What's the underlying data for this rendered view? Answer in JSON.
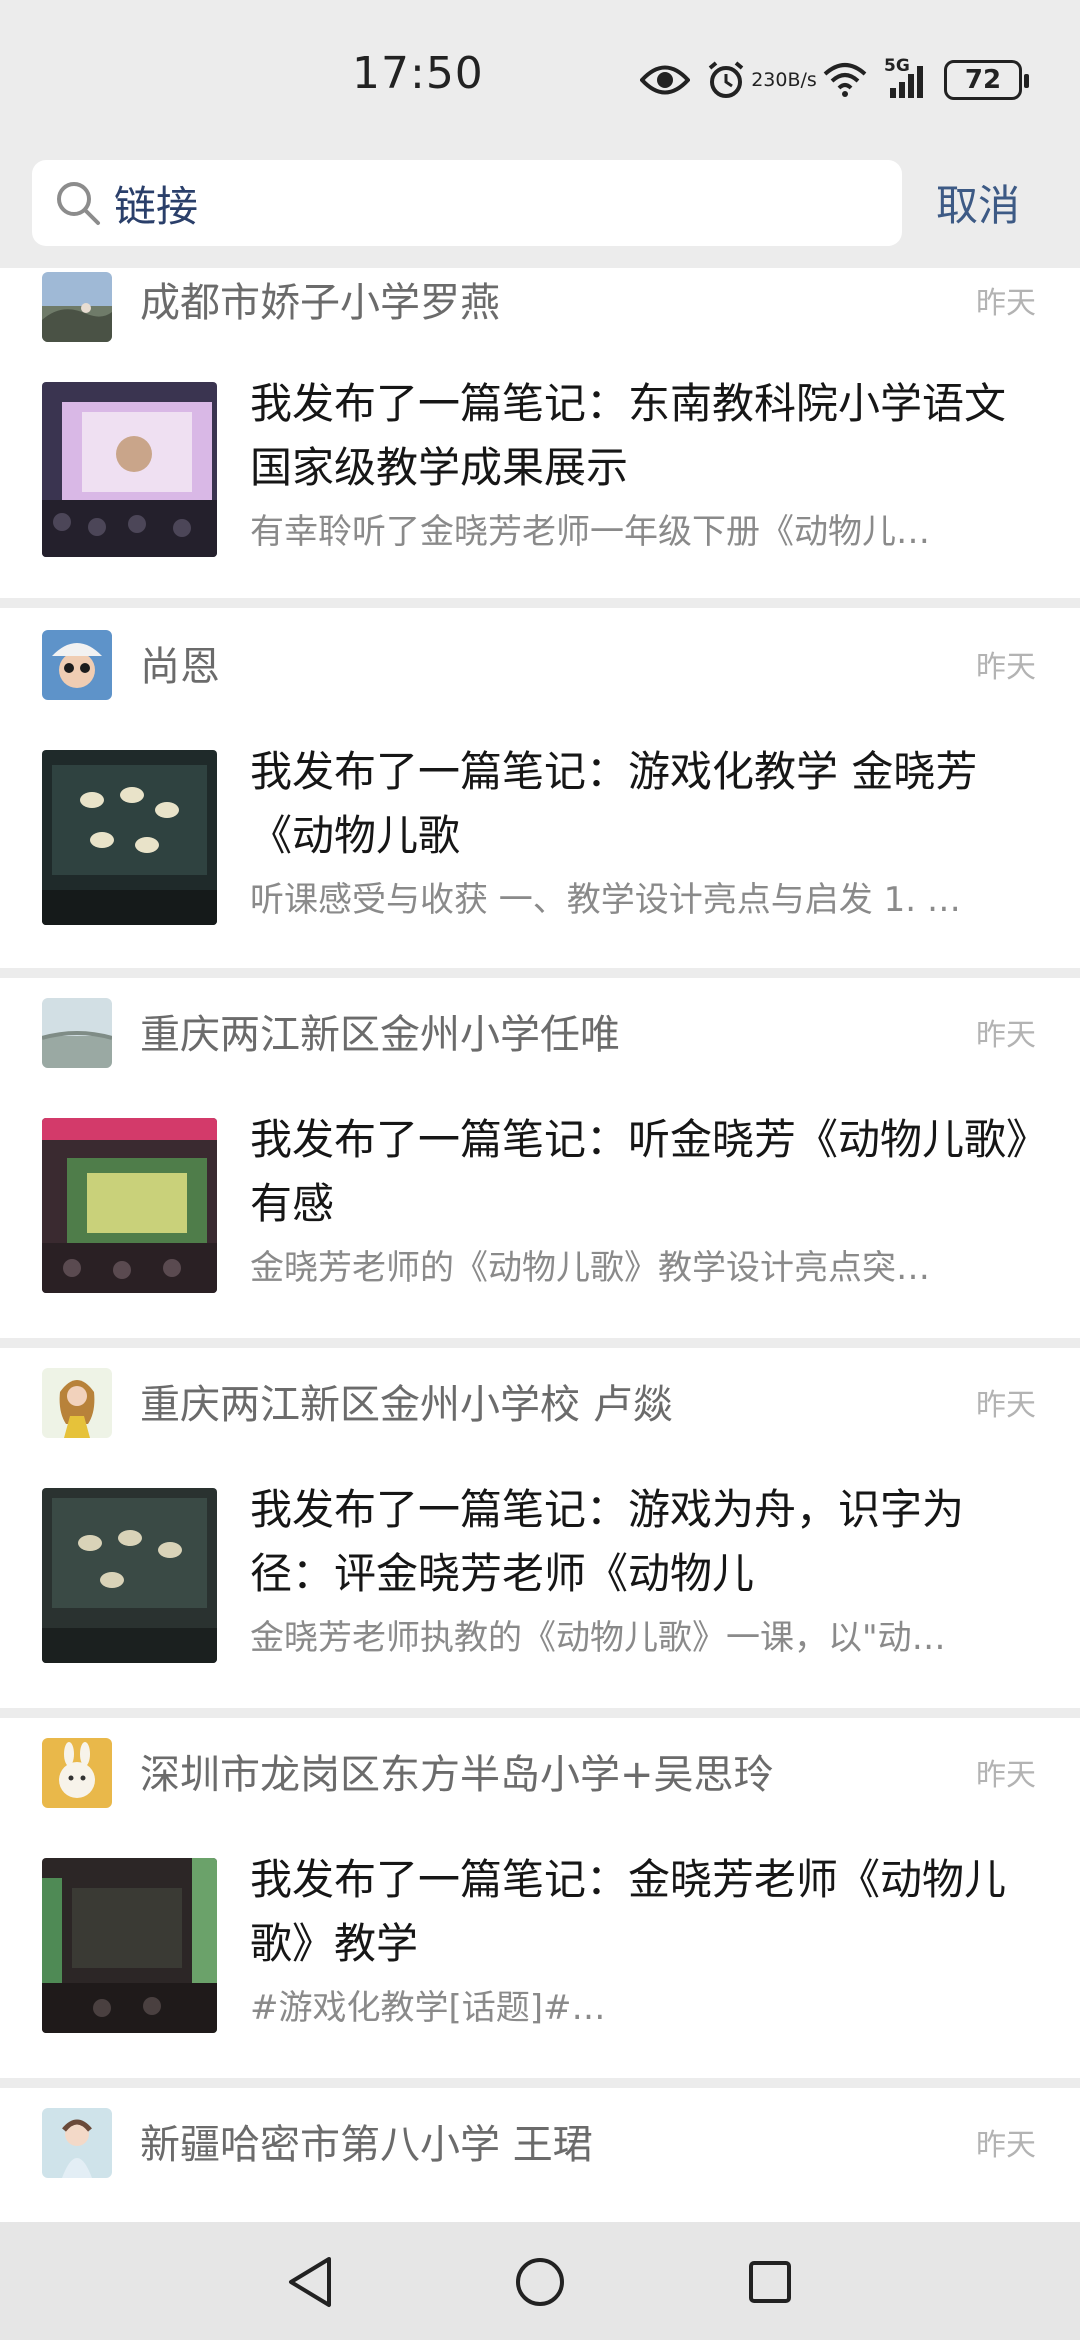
{
  "status_bar": {
    "time": "17:50",
    "net_speed_value": "230",
    "net_speed_unit": "B/s",
    "network": "5G",
    "battery": "72"
  },
  "search": {
    "value": "链接",
    "cancel_label": "取消"
  },
  "feed": [
    {
      "author": "成都市娇子小学罗燕",
      "time": "昨天",
      "title": "我发布了一篇笔记：东南教科院小学语文国家级教学成果展示",
      "snippet": "有幸聆听了金晓芳老师一年级下册《动物儿…"
    },
    {
      "author": "尚恩",
      "time": "昨天",
      "title": "我发布了一篇笔记：游戏化教学 金晓芳《动物儿歌",
      "snippet": "听课感受与收获 一、教学设计亮点与启发 1. …"
    },
    {
      "author": "重庆两江新区金州小学任唯",
      "time": "昨天",
      "title": "我发布了一篇笔记：听金晓芳《动物儿歌》有感",
      "snippet": "金晓芳老师的《动物儿歌》教学设计亮点突…"
    },
    {
      "author": "重庆两江新区金州小学校  卢燚",
      "time": "昨天",
      "title": "我发布了一篇笔记：游戏为舟，识字为径：评金晓芳老师《动物儿",
      "snippet": "金晓芳老师执教的《动物儿歌》一课，以\"动…"
    },
    {
      "author": "深圳市龙岗区东方半岛小学+吴思玲",
      "time": "昨天",
      "title": "我发布了一篇笔记：金晓芳老师《动物儿歌》教学",
      "snippet": "#游戏化教学[话题]#…"
    },
    {
      "author": "新疆哈密市第八小学  王珺",
      "time": "昨天"
    }
  ],
  "icons": {
    "search": "search-icon",
    "back": "back-triangle-icon",
    "home": "home-circle-icon",
    "recents": "recents-square-icon"
  },
  "colors": {
    "background": "#ececec",
    "card": "#ffffff",
    "cancel": "#3d5a85",
    "author": "#6b6b6b",
    "snippet": "#8a8a8a"
  }
}
